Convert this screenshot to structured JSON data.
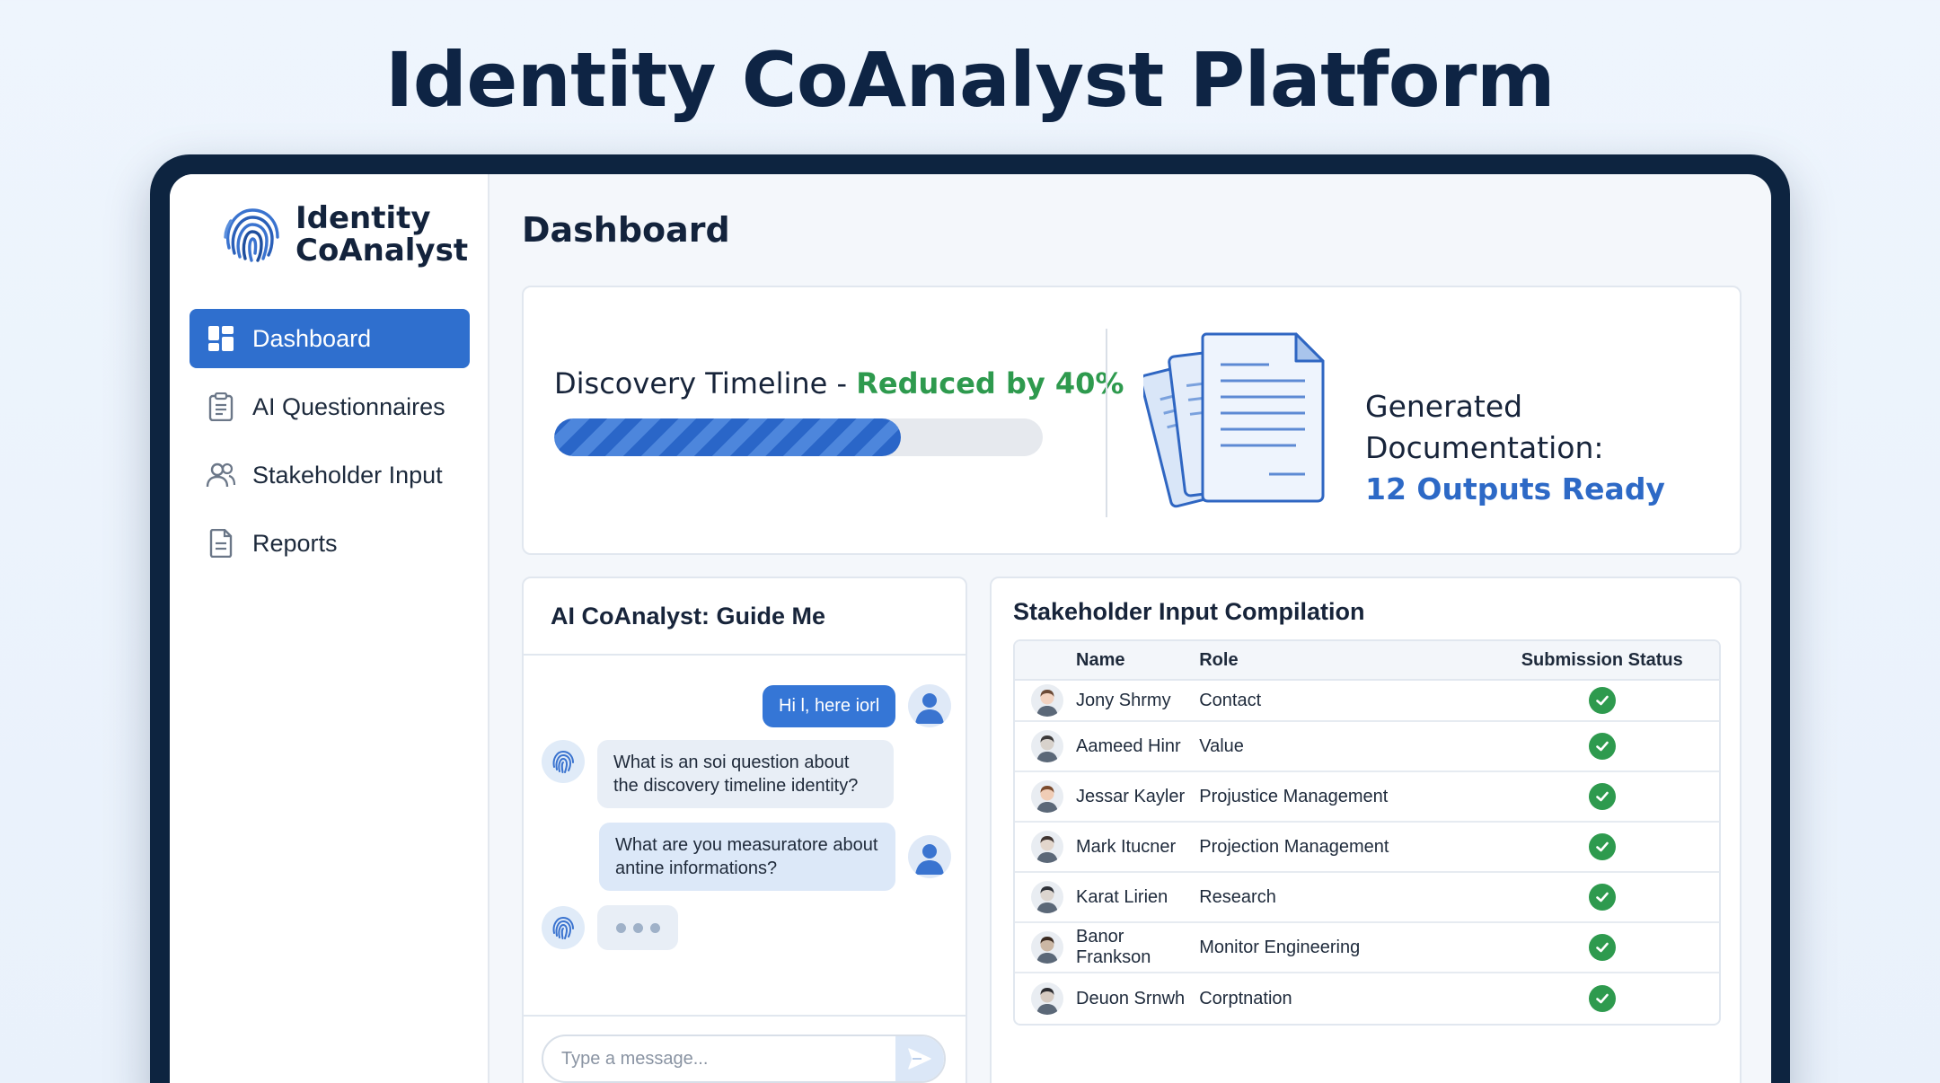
{
  "banner": {
    "title": "Identity CoAnalyst Platform"
  },
  "app": {
    "logo_line1": "Identity",
    "logo_line2": "CoAnalyst"
  },
  "sidebar": {
    "items": [
      {
        "label": "Dashboard",
        "icon": "dashboard-icon",
        "active": true
      },
      {
        "label": "AI Questionnaires",
        "icon": "clipboard-icon",
        "active": false
      },
      {
        "label": "Stakeholder Input",
        "icon": "users-icon",
        "active": false
      },
      {
        "label": "Reports",
        "icon": "document-icon",
        "active": false
      }
    ]
  },
  "main": {
    "title": "Dashboard",
    "timeline": {
      "label": "Discovery Timeline - ",
      "highlight": "Reduced by 40%",
      "progress_fraction": 0.71,
      "accent_color": "#2e9a4e"
    },
    "docs": {
      "label": "Generated Documentation:",
      "value": "12 Outputs Ready",
      "accent_color": "#2d69c6"
    }
  },
  "chat": {
    "title": "AI CoAnalyst: Guide Me",
    "messages": [
      {
        "from": "user",
        "text": "Hi l, here iorl"
      },
      {
        "from": "ai",
        "text": "What is an soi question about the discovery timeline identity?"
      },
      {
        "from": "user",
        "text": "What are you measuratore about antine informations?"
      }
    ],
    "input_placeholder": "Type a message..."
  },
  "stakeholders": {
    "title": "Stakeholder Input Compilation",
    "columns": [
      "Name",
      "Role",
      "Submission Status"
    ],
    "rows": [
      {
        "name": "Jony Shrmy",
        "role": "Contact",
        "status": "submitted"
      },
      {
        "name": "Aameed Hinr",
        "role": "Value",
        "status": "submitted"
      },
      {
        "name": "Jessar Kayler",
        "role": "Projustice Management",
        "status": "submitted"
      },
      {
        "name": "Mark Itucner",
        "role": "Projection Management",
        "status": "submitted"
      },
      {
        "name": "Karat Lirien",
        "role": "Research",
        "status": "submitted"
      },
      {
        "name": "Banor Frankson",
        "role": "Monitor Engineering",
        "status": "submitted"
      },
      {
        "name": "Deuon Srnwh",
        "role": "Corptnation",
        "status": "submitted"
      }
    ]
  }
}
